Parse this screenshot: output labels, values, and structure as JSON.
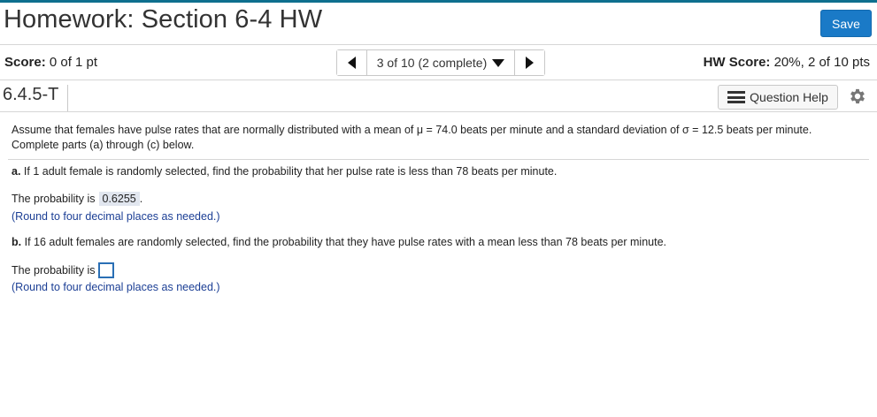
{
  "header": {
    "title": "Homework: Section 6-4 HW",
    "save_label": "Save"
  },
  "status": {
    "score_label": "Score:",
    "score_value": "0 of 1 pt",
    "nav_text": "3 of 10 (2 complete)",
    "hw_score_label": "HW Score:",
    "hw_score_value": "20%, 2 of 10 pts"
  },
  "question": {
    "id": "6.4.5-T",
    "help_label": "Question Help",
    "intro": "Assume that females have pulse rates that are normally distributed with a mean of μ = 74.0 beats per minute and a standard deviation of σ = 12.5 beats per minute. Complete parts (a) through (c) below.",
    "part_a_label": "a.",
    "part_a_text": "If 1 adult female is randomly selected, find the probability that her pulse rate is less than 78 beats per minute.",
    "part_a_answer_prefix": "The probability is",
    "part_a_answer": "0.6255",
    "part_a_period": ".",
    "part_a_hint": "(Round to four decimal places as needed.)",
    "part_b_label": "b.",
    "part_b_text": "If 16 adult females are randomly selected, find the probability that they have pulse rates with a mean less than 78 beats per minute.",
    "part_b_answer_prefix": "The probability is",
    "part_b_answer": "",
    "part_b_hint": "(Round to four decimal places as needed.)"
  },
  "colors": {
    "accent": "#0e6f8e",
    "save_button": "#1a7ac7",
    "hint_text": "#1c3f95",
    "answer_bg": "#e1e6ef"
  },
  "icons": [
    "chevron-left-icon",
    "chevron-right-icon",
    "dropdown-triangle-icon",
    "list-icon",
    "gear-icon"
  ]
}
